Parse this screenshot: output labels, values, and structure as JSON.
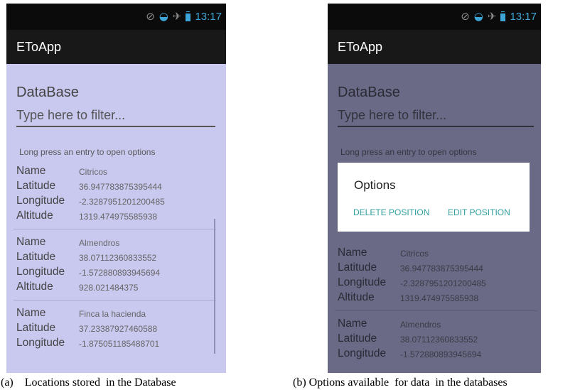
{
  "status_bar": {
    "time": "13:17",
    "icons": [
      "signal-off-icon",
      "wifi-icon",
      "airplane-mode-icon",
      "battery-icon"
    ]
  },
  "app": {
    "title": "EToApp",
    "section_title": "DataBase",
    "filter_placeholder": "Type here to filter...",
    "hint": "Long press an entry to open options"
  },
  "field_labels": {
    "name": "Name",
    "latitude": "Latitude",
    "longitude": "Longitude",
    "altitude": "Altitude"
  },
  "entries": [
    {
      "name": "Citricos",
      "latitude": "36.947783875395444",
      "longitude": "-2.3287951201200485",
      "altitude": "1319.474975585938"
    },
    {
      "name": "Almendros",
      "latitude": "38.07112360833552",
      "longitude": "-1.572880893945694",
      "altitude": "928.021484375"
    },
    {
      "name": "Finca la hacienda",
      "latitude": "37.23387927460588",
      "longitude": "-1.875051185488701",
      "altitude": ""
    }
  ],
  "dialog": {
    "title": "Options",
    "delete_label": "DELETE POSITION",
    "edit_label": "EDIT POSITION"
  },
  "captions": {
    "a": "(a)    Locations stored  in the Database",
    "b": "(b) Options available  for data  in the databases"
  },
  "colors": {
    "content_bg": "#c9c8ef",
    "bar_bg": "#181818",
    "accent": "#3ea6d6",
    "dialog_button": "#2f9e9e"
  }
}
